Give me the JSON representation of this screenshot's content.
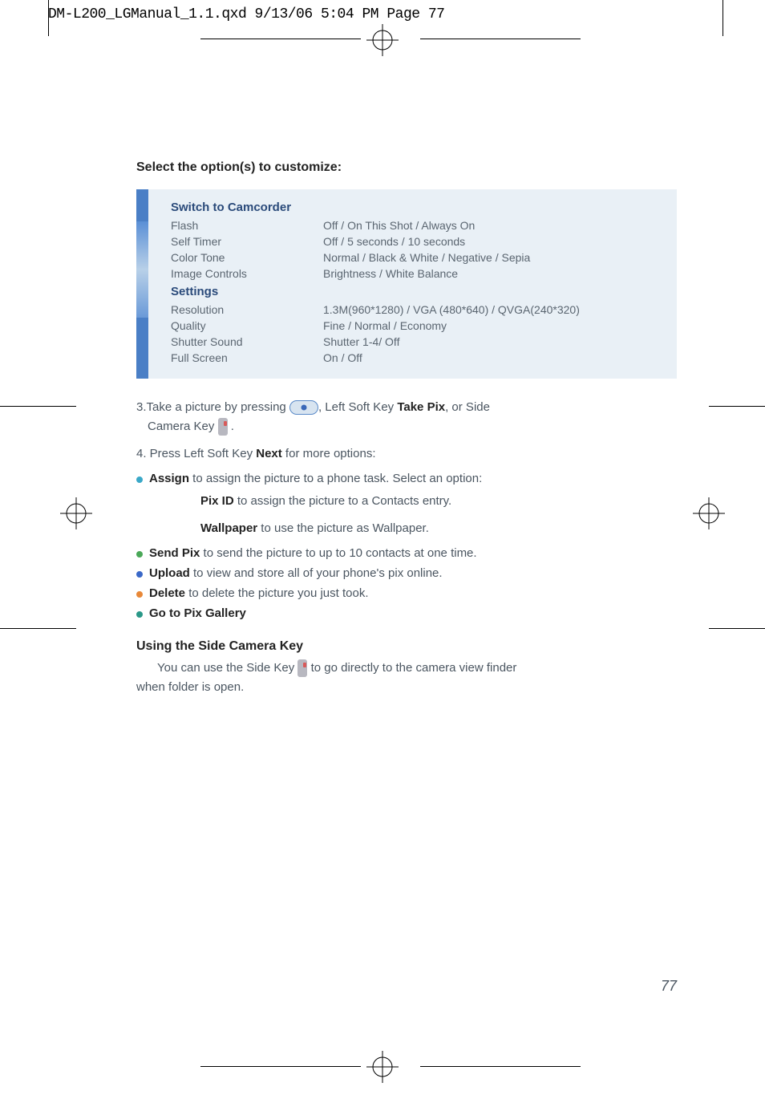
{
  "header": "DM-L200_LGManual_1.1.qxd  9/13/06  5:04 PM  Page 77",
  "section_title": "Select the option(s) to customize:",
  "box": {
    "subtitle1": "Switch to Camcorder",
    "rows1": [
      {
        "label": "Flash",
        "value": "Off / On This Shot / Always On"
      },
      {
        "label": "Self Timer",
        "value": "Off / 5 seconds / 10 seconds"
      },
      {
        "label": "Color Tone",
        "value": "Normal / Black & White / Negative / Sepia"
      },
      {
        "label": "Image Controls",
        "value": "Brightness / White Balance"
      }
    ],
    "subtitle2": "Settings",
    "rows2": [
      {
        "label": "Resolution",
        "value": "1.3M(960*1280) / VGA (480*640) / QVGA(240*320)"
      },
      {
        "label": "Quality",
        "value": "Fine / Normal / Economy"
      },
      {
        "label": "Shutter Sound",
        "value": "Shutter 1-4/ Off"
      },
      {
        "label": "Full Screen",
        "value": "On / Off"
      }
    ]
  },
  "step3_a": "3.Take a picture by pressing ",
  "step3_b": ", Left Soft Key ",
  "step3_bold": "Take Pix",
  "step3_c": ", or Side",
  "step3_d": "Camera Key ",
  "step3_e": " .",
  "step4_a": "4. Press Left Soft Key ",
  "step4_bold": "Next",
  "step4_b": " for more options:",
  "bullets": {
    "assign_bold": "Assign",
    "assign_text": " to assign the picture to a phone task. Select an option:",
    "pixid_bold": "Pix ID",
    "pixid_text": " to assign the picture to a Contacts entry.",
    "wallpaper_bold": "Wallpaper",
    "wallpaper_text": " to use the picture as Wallpaper.",
    "sendpix_bold": "Send Pix",
    "sendpix_text": " to send the picture to up to 10 contacts at one time.",
    "upload_bold": "Upload",
    "upload_text": " to view and store all of your phone's pix online.",
    "delete_bold": "Delete",
    "delete_text": " to delete the picture you just took.",
    "gallery_bold": "Go to Pix Gallery"
  },
  "subsection_title": "Using the Side Camera Key",
  "sub_a": "You can use the Side Key ",
  "sub_b": " to go directly to the camera view finder",
  "sub_c": "when folder is open.",
  "page_number": "77"
}
